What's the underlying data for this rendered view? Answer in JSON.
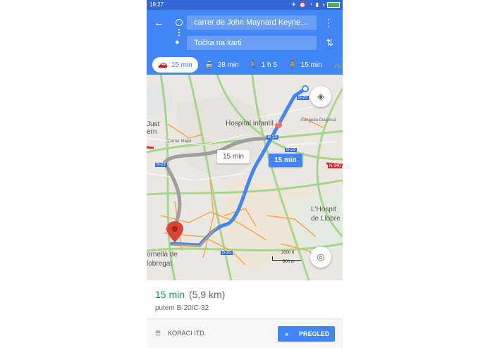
{
  "status_bar": {
    "time": "18:27",
    "icons": "✈ ⏰ ◔ ▮ ◑"
  },
  "header": {
    "back_icon": "←",
    "origin": "carrer de John Maynard Keyne…",
    "destination": "Točka na karti",
    "more_icon": "⋮",
    "swap_icon": "⇅"
  },
  "modes": [
    {
      "icon": "car-icon",
      "glyph": "🚗",
      "label": "15 min",
      "active": true
    },
    {
      "icon": "bus-icon",
      "glyph": "🚆",
      "label": "28 min",
      "active": false
    },
    {
      "icon": "walk-icon",
      "glyph": "🚶",
      "label": "1 h 5",
      "active": false
    },
    {
      "icon": "ride-icon",
      "glyph": "🧍",
      "label": "15 min",
      "active": false
    },
    {
      "icon": "bike-icon",
      "glyph": "🚲",
      "label": "",
      "active": false
    }
  ],
  "map": {
    "labels": {
      "hospital_infantil": "Hospital infantil",
      "hospitalet": "L'Hospit",
      "de_llobre": "de Llobre",
      "cornella": "ornellà de",
      "llobregat": "lobregat",
      "just": "Just",
      "ern": "ern",
      "carrer_major": "Carrer Major",
      "avinguda_diagonal": "Avinguda Diagonal"
    },
    "shields": [
      "B-20",
      "B-23",
      "B-23",
      "N-340",
      "B-20",
      "B-23"
    ],
    "callout_alt": "15 min",
    "callout_main": "15 min",
    "scale": {
      "ft": "2000 ft",
      "m": "500 m"
    },
    "hospital_marker": "H"
  },
  "summary": {
    "duration": "15 min",
    "distance": "(5,9 km)",
    "via": "putem B-20/C-32"
  },
  "bottom": {
    "steps_label": "KORACI ITD.",
    "preview_label": "PREGLED"
  },
  "colors": {
    "accent": "#4285f4",
    "green": "#0f9d58",
    "status_bar": "#3367d6"
  }
}
